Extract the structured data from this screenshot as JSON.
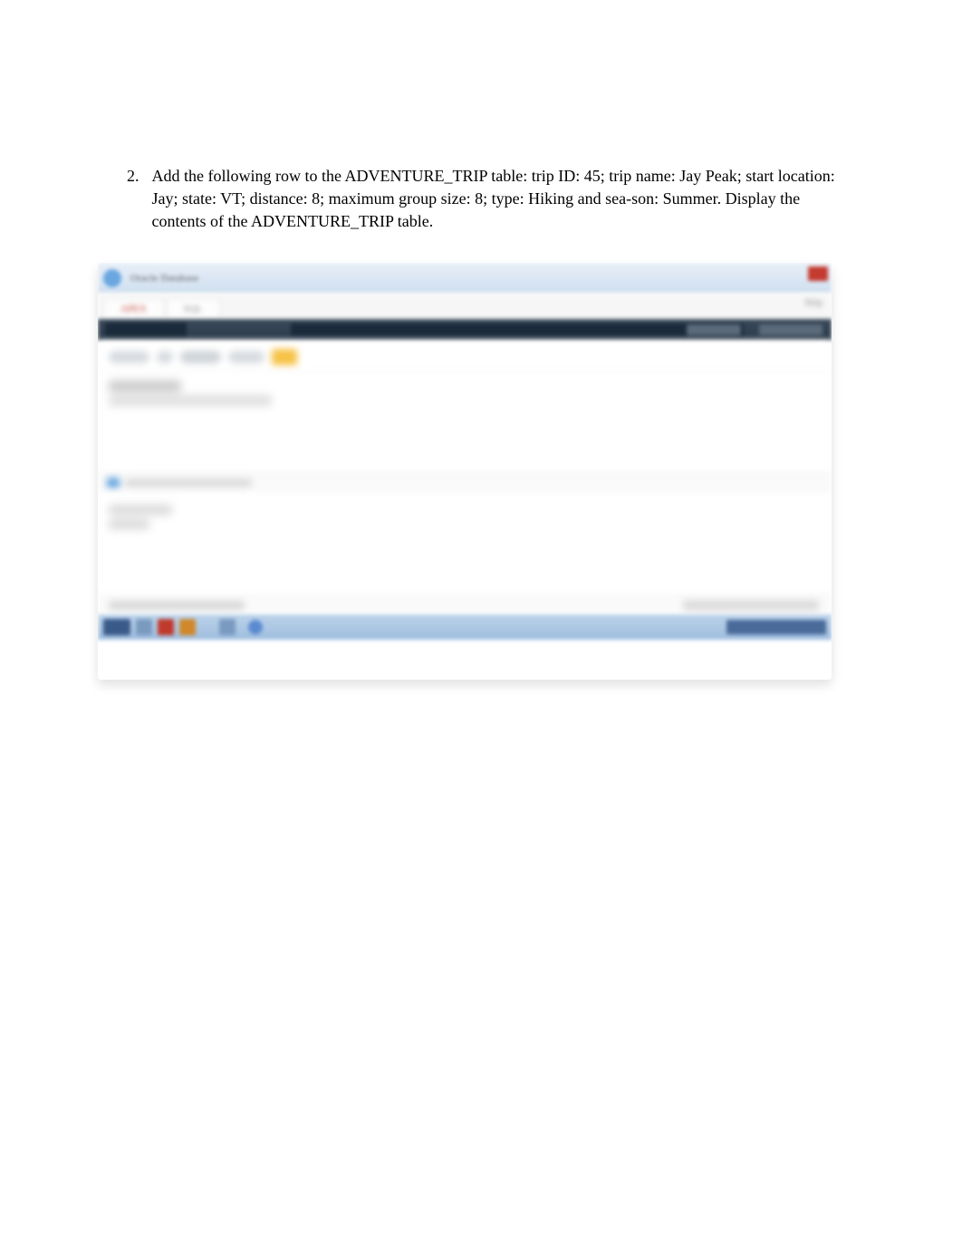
{
  "question": {
    "number": "2.",
    "text": "Add the following row to the ADVENTURE_TRIP table: trip ID: 45; trip name: Jay Peak; start location: Jay; state: VT; distance: 8; maximum group size: 8; type: Hiking and sea-son: Summer. Display the contents of the ADVENTURE_TRIP table."
  },
  "app": {
    "window_title": "Oracle Database",
    "tab1": "APEX",
    "tab2": "SQL",
    "right_link": "Help"
  }
}
